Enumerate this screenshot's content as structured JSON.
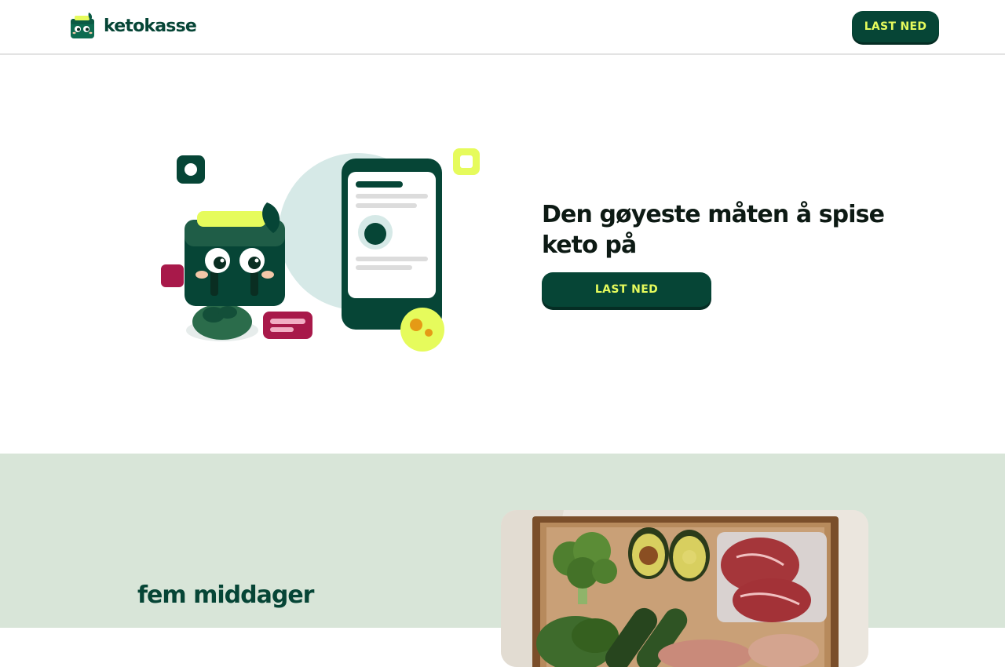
{
  "header": {
    "brand": "ketokasse",
    "cta_label": "LAST NED"
  },
  "hero": {
    "title": "Den gøyeste måten å spise keto på",
    "cta_label": "LAST NED"
  },
  "section2": {
    "title": "fem middager"
  },
  "colors": {
    "brand_green": "#064536",
    "accent_lime": "#e6fb5c",
    "section_bg": "#d8e5d8",
    "accent_berry": "#a8194a"
  },
  "icons": [
    "ketokasse-logo-icon",
    "phone-app-illustration",
    "box-mascot-illustration"
  ]
}
